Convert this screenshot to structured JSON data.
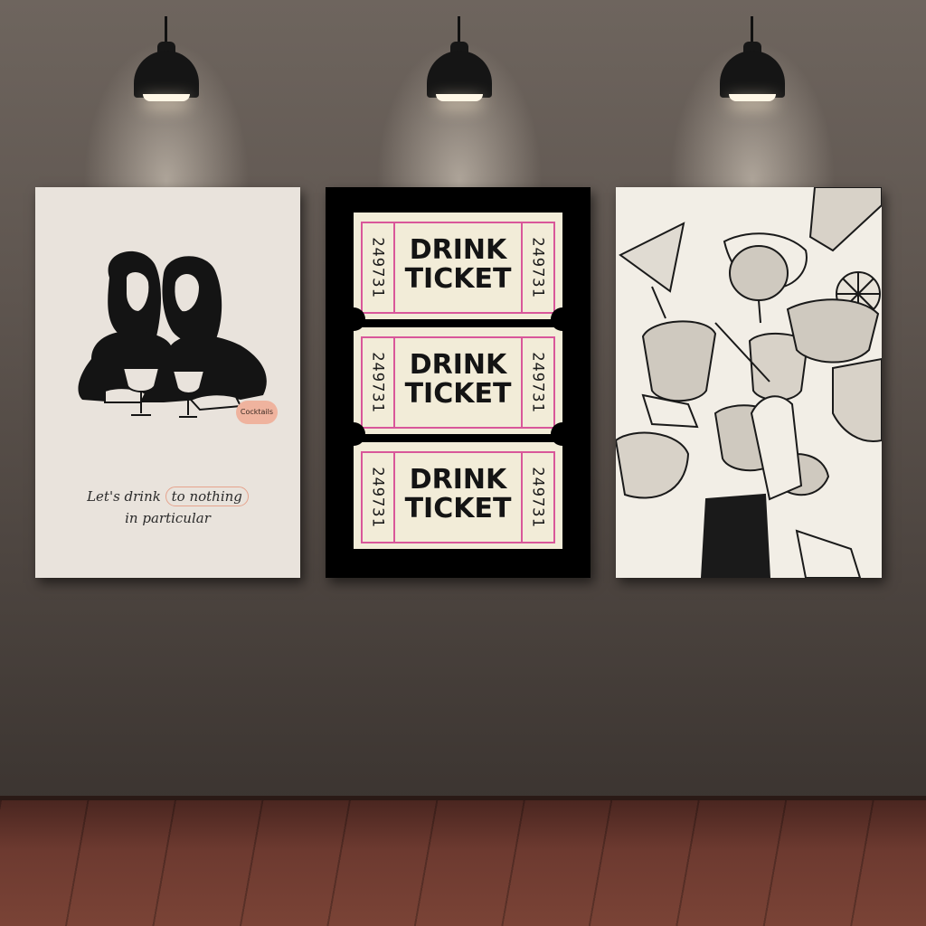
{
  "scene": {
    "description_colors": {
      "wall": "#5f5650",
      "floor": "#6d3a30",
      "lamp": "#151515"
    }
  },
  "poster_left": {
    "icon": "women-toasting-illustration",
    "badge": "Cocktails",
    "quote_line1_prefix": "Let's drink ",
    "quote_line1_circled": "to nothing",
    "quote_line2": "in particular",
    "accent": "#e6a38d"
  },
  "poster_middle": {
    "tickets": [
      {
        "number": "249731",
        "line1": "DRINK",
        "line2": "TICKET"
      },
      {
        "number": "249731",
        "line1": "DRINK",
        "line2": "TICKET"
      },
      {
        "number": "249731",
        "line1": "DRINK",
        "line2": "TICKET"
      }
    ],
    "border_color": "#d9579a"
  },
  "poster_right": {
    "icon": "cocktail-glasses-toast-sketch"
  }
}
